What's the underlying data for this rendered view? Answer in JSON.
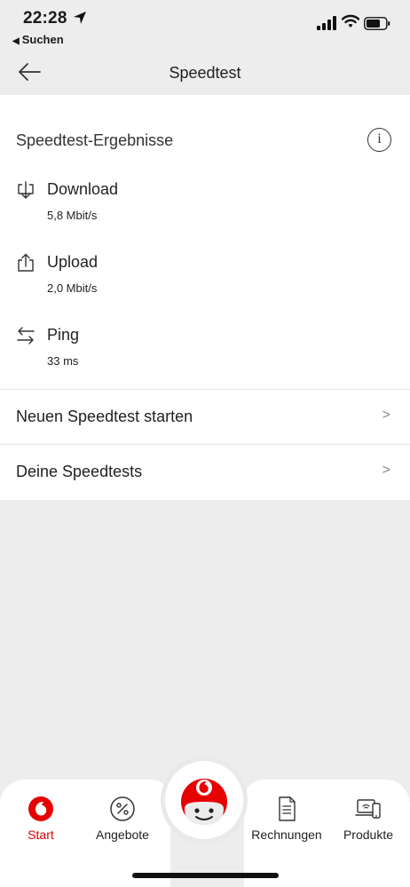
{
  "status": {
    "time": "22:28",
    "back_app": "Suchen"
  },
  "nav": {
    "title": "Speedtest"
  },
  "results": {
    "title": "Speedtest-Ergebnisse",
    "metrics": [
      {
        "label": "Download",
        "value": "5,8 Mbit/s",
        "icon": "download-icon"
      },
      {
        "label": "Upload",
        "value": "2,0 Mbit/s",
        "icon": "upload-icon"
      },
      {
        "label": "Ping",
        "value": "33 ms",
        "icon": "ping-arrows-icon"
      }
    ]
  },
  "actions": [
    {
      "label": "Neuen Speedtest starten"
    },
    {
      "label": "Deine Speedtests"
    }
  ],
  "tabs": [
    {
      "label": "Start",
      "icon": "vodafone-logo-icon",
      "active": true
    },
    {
      "label": "Angebote",
      "icon": "percent-icon",
      "active": false
    },
    {
      "label": "Rechnungen",
      "icon": "invoice-icon",
      "active": false
    },
    {
      "label": "Produkte",
      "icon": "devices-icon",
      "active": false
    }
  ],
  "colors": {
    "accent": "#e60000",
    "background": "#ededed",
    "card": "#ffffff"
  }
}
